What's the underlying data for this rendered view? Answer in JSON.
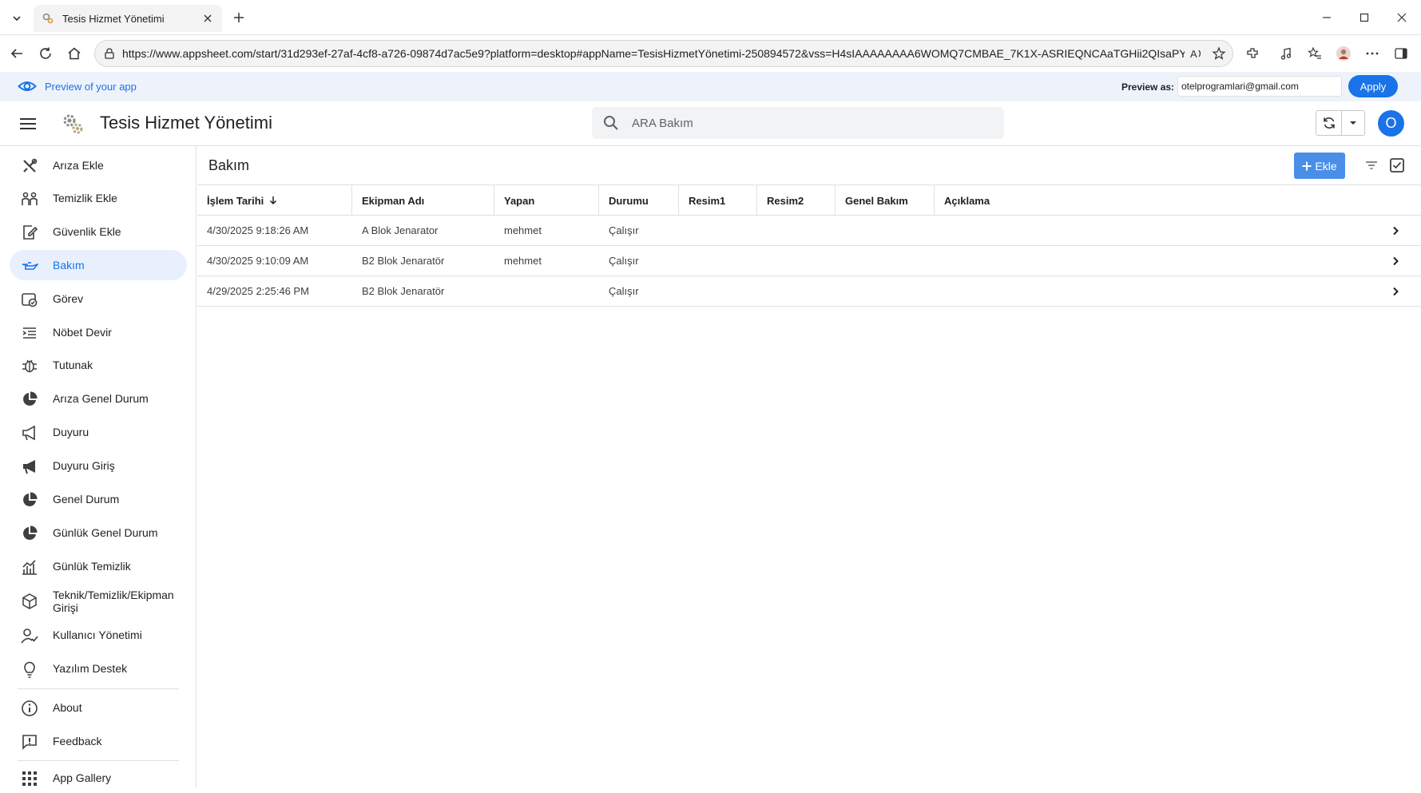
{
  "browser": {
    "tab_title": "Tesis Hizmet Yönetimi",
    "url": "https://www.appsheet.com/start/31d293ef-27af-4cf8-a726-09874d7ac5e9?platform=desktop#appName=TesisHizmetYönetimi-250894572&vss=H4sIAAAAAAAA6WOMQ7CMBAE_7K1X-ASRIEQNCAaTGHii2QIsaPY..."
  },
  "preview": {
    "label": "Preview of your app",
    "preview_as_label": "Preview as:",
    "email": "otelprogramlari@gmail.com",
    "apply_label": "Apply"
  },
  "header": {
    "app_title": "Tesis Hizmet Yönetimi",
    "search_placeholder": "ARA Bakım",
    "avatar_letter": "O"
  },
  "sidebar": {
    "items": [
      {
        "label": "Arıza Ekle",
        "icon": "tools-icon"
      },
      {
        "label": "Temizlik Ekle",
        "icon": "people-icon"
      },
      {
        "label": "Güvenlik Ekle",
        "icon": "edit-document-icon"
      },
      {
        "label": "Bakım",
        "icon": "oil-can-icon",
        "active": true
      },
      {
        "label": "Görev",
        "icon": "task-card-icon"
      },
      {
        "label": "Nöbet Devir",
        "icon": "list-indent-icon"
      },
      {
        "label": "Tutunak",
        "icon": "bug-icon"
      },
      {
        "label": "Arıza Genel Durum",
        "icon": "pie-chart-icon"
      },
      {
        "label": "Duyuru",
        "icon": "megaphone-outline-icon"
      },
      {
        "label": "Duyuru Giriş",
        "icon": "megaphone-icon"
      },
      {
        "label": "Genel Durum",
        "icon": "pie-chart-icon"
      },
      {
        "label": "Günlük Genel Durum",
        "icon": "pie-chart-icon"
      },
      {
        "label": "Günlük Temizlik",
        "icon": "bar-chart-icon"
      },
      {
        "label": "Teknik/Temizlik/Ekipman Girişi",
        "icon": "cube-icon"
      },
      {
        "label": "Kullanıcı Yönetimi",
        "icon": "user-check-icon"
      },
      {
        "label": "Yazılım Destek",
        "icon": "lightbulb-icon"
      }
    ],
    "about_label": "About",
    "feedback_label": "Feedback",
    "gallery_label": "App Gallery"
  },
  "main": {
    "view_title": "Bakım",
    "add_label": "Ekle",
    "columns": [
      "İşlem Tarihi",
      "Ekipman Adı",
      "Yapan",
      "Durumu",
      "Resim1",
      "Resim2",
      "Genel Bakım",
      "Açıklama"
    ],
    "rows": [
      {
        "tarih": "4/30/2025 9:18:26 AM",
        "ekipman": "A Blok Jenarator",
        "yapan": "mehmet",
        "durum": "Çalışır"
      },
      {
        "tarih": "4/30/2025 9:10:09 AM",
        "ekipman": "B2 Blok Jenaratör",
        "yapan": "mehmet",
        "durum": "Çalışır"
      },
      {
        "tarih": "4/29/2025 2:25:46 PM",
        "ekipman": "B2 Blok Jenaratör",
        "yapan": "",
        "durum": "Çalışır"
      }
    ]
  },
  "colors": {
    "accent": "#1a73e8",
    "add_button": "#4a8fe7",
    "active_nav": "#e8f0fe",
    "preview_bar": "#eef3fb"
  }
}
